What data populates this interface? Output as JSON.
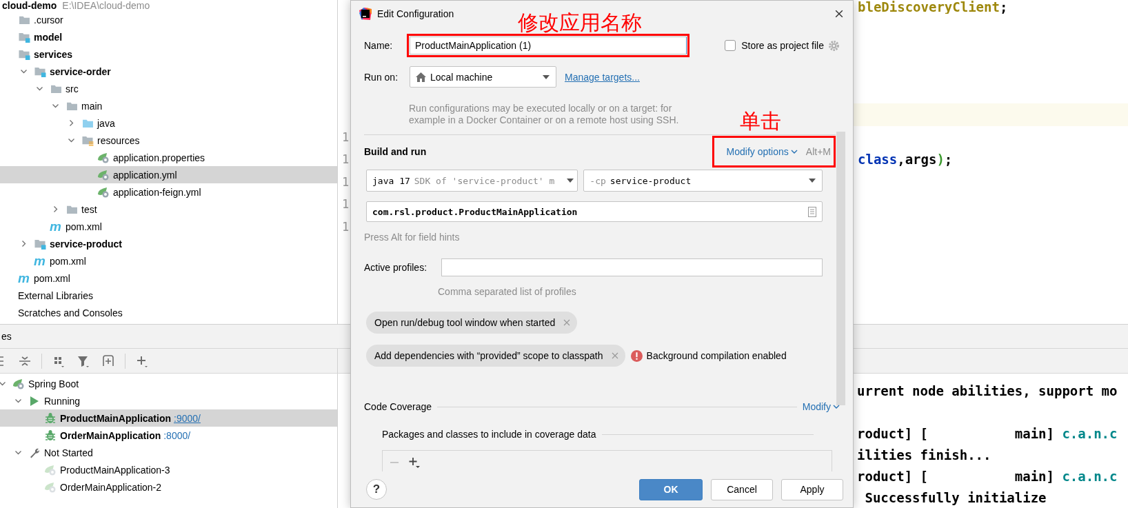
{
  "project_tree": {
    "root": {
      "name": "cloud-demo",
      "path": "E:\\IDEA\\cloud-demo"
    },
    "items": [
      {
        "name": ".cursor",
        "kind": "folder",
        "bold": false,
        "selected": false
      },
      {
        "name": "model",
        "kind": "module",
        "bold": true,
        "selected": false
      },
      {
        "name": "services",
        "kind": "module",
        "bold": true,
        "selected": false,
        "children": [
          {
            "name": "service-order",
            "kind": "module",
            "bold": true,
            "selected": false,
            "expanded": true,
            "children": [
              {
                "name": "src",
                "kind": "folder",
                "bold": false,
                "selected": false,
                "expanded": true,
                "children": [
                  {
                    "name": "main",
                    "kind": "folder",
                    "bold": false,
                    "selected": false,
                    "expanded": true,
                    "children": [
                      {
                        "name": "java",
                        "kind": "source",
                        "bold": false,
                        "selected": false,
                        "expanded": false
                      },
                      {
                        "name": "resources",
                        "kind": "resources",
                        "bold": false,
                        "selected": false,
                        "expanded": true,
                        "children": [
                          {
                            "name": "application.properties",
                            "kind": "spring",
                            "bold": false,
                            "selected": false
                          },
                          {
                            "name": "application.yml",
                            "kind": "spring",
                            "bold": false,
                            "selected": true
                          },
                          {
                            "name": "application-feign.yml",
                            "kind": "spring",
                            "bold": false,
                            "selected": false
                          }
                        ]
                      }
                    ]
                  },
                  {
                    "name": "test",
                    "kind": "folder",
                    "bold": false,
                    "selected": false,
                    "expanded": false
                  }
                ]
              },
              {
                "name": "pom.xml",
                "kind": "maven",
                "glyph": "m",
                "bold": false,
                "selected": false
              }
            ]
          },
          {
            "name": "service-product",
            "kind": "module",
            "bold": true,
            "selected": false,
            "expanded": false
          },
          {
            "name": "pom.xml",
            "kind": "maven",
            "glyph": "m",
            "bold": false,
            "selected": false
          }
        ]
      },
      {
        "name": "pom.xml",
        "kind": "maven",
        "glyph": "m",
        "bold": false,
        "selected": false
      },
      {
        "name": "External Libraries",
        "kind": "plain",
        "bold": false,
        "selected": false
      },
      {
        "name": "Scratches and Consoles",
        "kind": "plain",
        "bold": false,
        "selected": false
      }
    ]
  },
  "editor": {
    "rows": [
      {
        "current": false,
        "tokens": [
          {
            "text": "bleDiscoveryClient",
            "kind": "annotation"
          },
          {
            "text": ";",
            "kind": "plain"
          }
        ]
      },
      {
        "current": false
      },
      {
        "current": false
      },
      {
        "current": false
      },
      {
        "current": false
      },
      {
        "current": true
      },
      {
        "current": false,
        "number": "1"
      },
      {
        "current": false,
        "number": "1",
        "tokens": [
          {
            "text": "class",
            "kind": "keyword"
          },
          {
            "text": ",args",
            "kind": "plain"
          },
          {
            "text": ")",
            "kind": "paren"
          },
          {
            "text": ";",
            "kind": "plain"
          }
        ]
      },
      {
        "current": false,
        "number": "1"
      },
      {
        "current": false,
        "number": "1"
      },
      {
        "current": false,
        "number": "1"
      }
    ]
  },
  "services_panel": {
    "title": "es",
    "tree": [
      {
        "label": "Spring Boot",
        "kind": "spring",
        "bold": false,
        "selected": false,
        "expanded": true,
        "children": [
          {
            "label": "Running",
            "kind": "run",
            "bold": false,
            "selected": false,
            "expanded": true,
            "children": [
              {
                "label": "ProductMainApplication",
                "kind": "bug",
                "bold": true,
                "selected": true,
                "port": ":9000/",
                "underlined": true
              },
              {
                "label": "OrderMainApplication",
                "kind": "bug",
                "bold": true,
                "selected": false,
                "port": ":8000/",
                "underlined": false
              }
            ]
          },
          {
            "label": "Not Started",
            "kind": "wrench",
            "bold": false,
            "selected": false,
            "expanded": true,
            "children": [
              {
                "label": "ProductMainApplication-3",
                "kind": "spring_faded",
                "bold": false,
                "selected": false
              },
              {
                "label": "OrderMainApplication-2",
                "kind": "spring_faded",
                "bold": false,
                "selected": false
              }
            ]
          }
        ]
      }
    ]
  },
  "console": {
    "blocks": [
      {
        "lines": [
          {
            "text": "urrent node abilities, support mo"
          }
        ]
      },
      {
        "lines": [
          {
            "text": "roduct] [           main] ",
            "logger": "c.a.n.c"
          },
          {
            "text": "ilities finish..."
          },
          {
            "text": "roduct] [           main] ",
            "logger": "c.a.n.c"
          },
          {
            "text": " Successfully initialize"
          }
        ]
      }
    ]
  },
  "dialog": {
    "title": "Edit Configuration",
    "name": {
      "label": "Name:",
      "value": "ProductMainApplication (1)",
      "annotation": "修改应用名称"
    },
    "store_as_project_file": {
      "label": "Store as project file",
      "checked": false
    },
    "run_on": {
      "label": "Run on:",
      "value": "Local machine",
      "link": "Manage targets...",
      "hint": "Run configurations may be executed locally or on a target: for example in a Docker Container or on a remote host using SSH."
    },
    "build_and_run": {
      "title": "Build and run",
      "modify_options": {
        "label": "Modify options",
        "shortcut": "Alt+M",
        "annotation": "单击"
      },
      "jre": {
        "value": "java 17",
        "hint": "SDK of 'service-product' m"
      },
      "classpath": {
        "prefix": "-cp",
        "value": "service-product"
      },
      "main_class": "com.rsl.product.ProductMainApplication",
      "field_hint": "Press Alt for field hints"
    },
    "active_profiles": {
      "label": "Active profiles:",
      "hint": "Comma separated list of profiles"
    },
    "options": [
      {
        "label": "Open run/debug tool window when started"
      },
      {
        "label": "Add dependencies with “provided” scope to classpath",
        "warning": "Background compilation enabled"
      }
    ],
    "code_coverage": {
      "title": "Code Coverage",
      "modify": "Modify",
      "packages_title": "Packages and classes to include in coverage data"
    },
    "help": "?",
    "buttons": [
      {
        "label": "OK",
        "default": true
      },
      {
        "label": "Cancel",
        "default": false
      },
      {
        "label": "Apply",
        "default": false
      }
    ]
  }
}
